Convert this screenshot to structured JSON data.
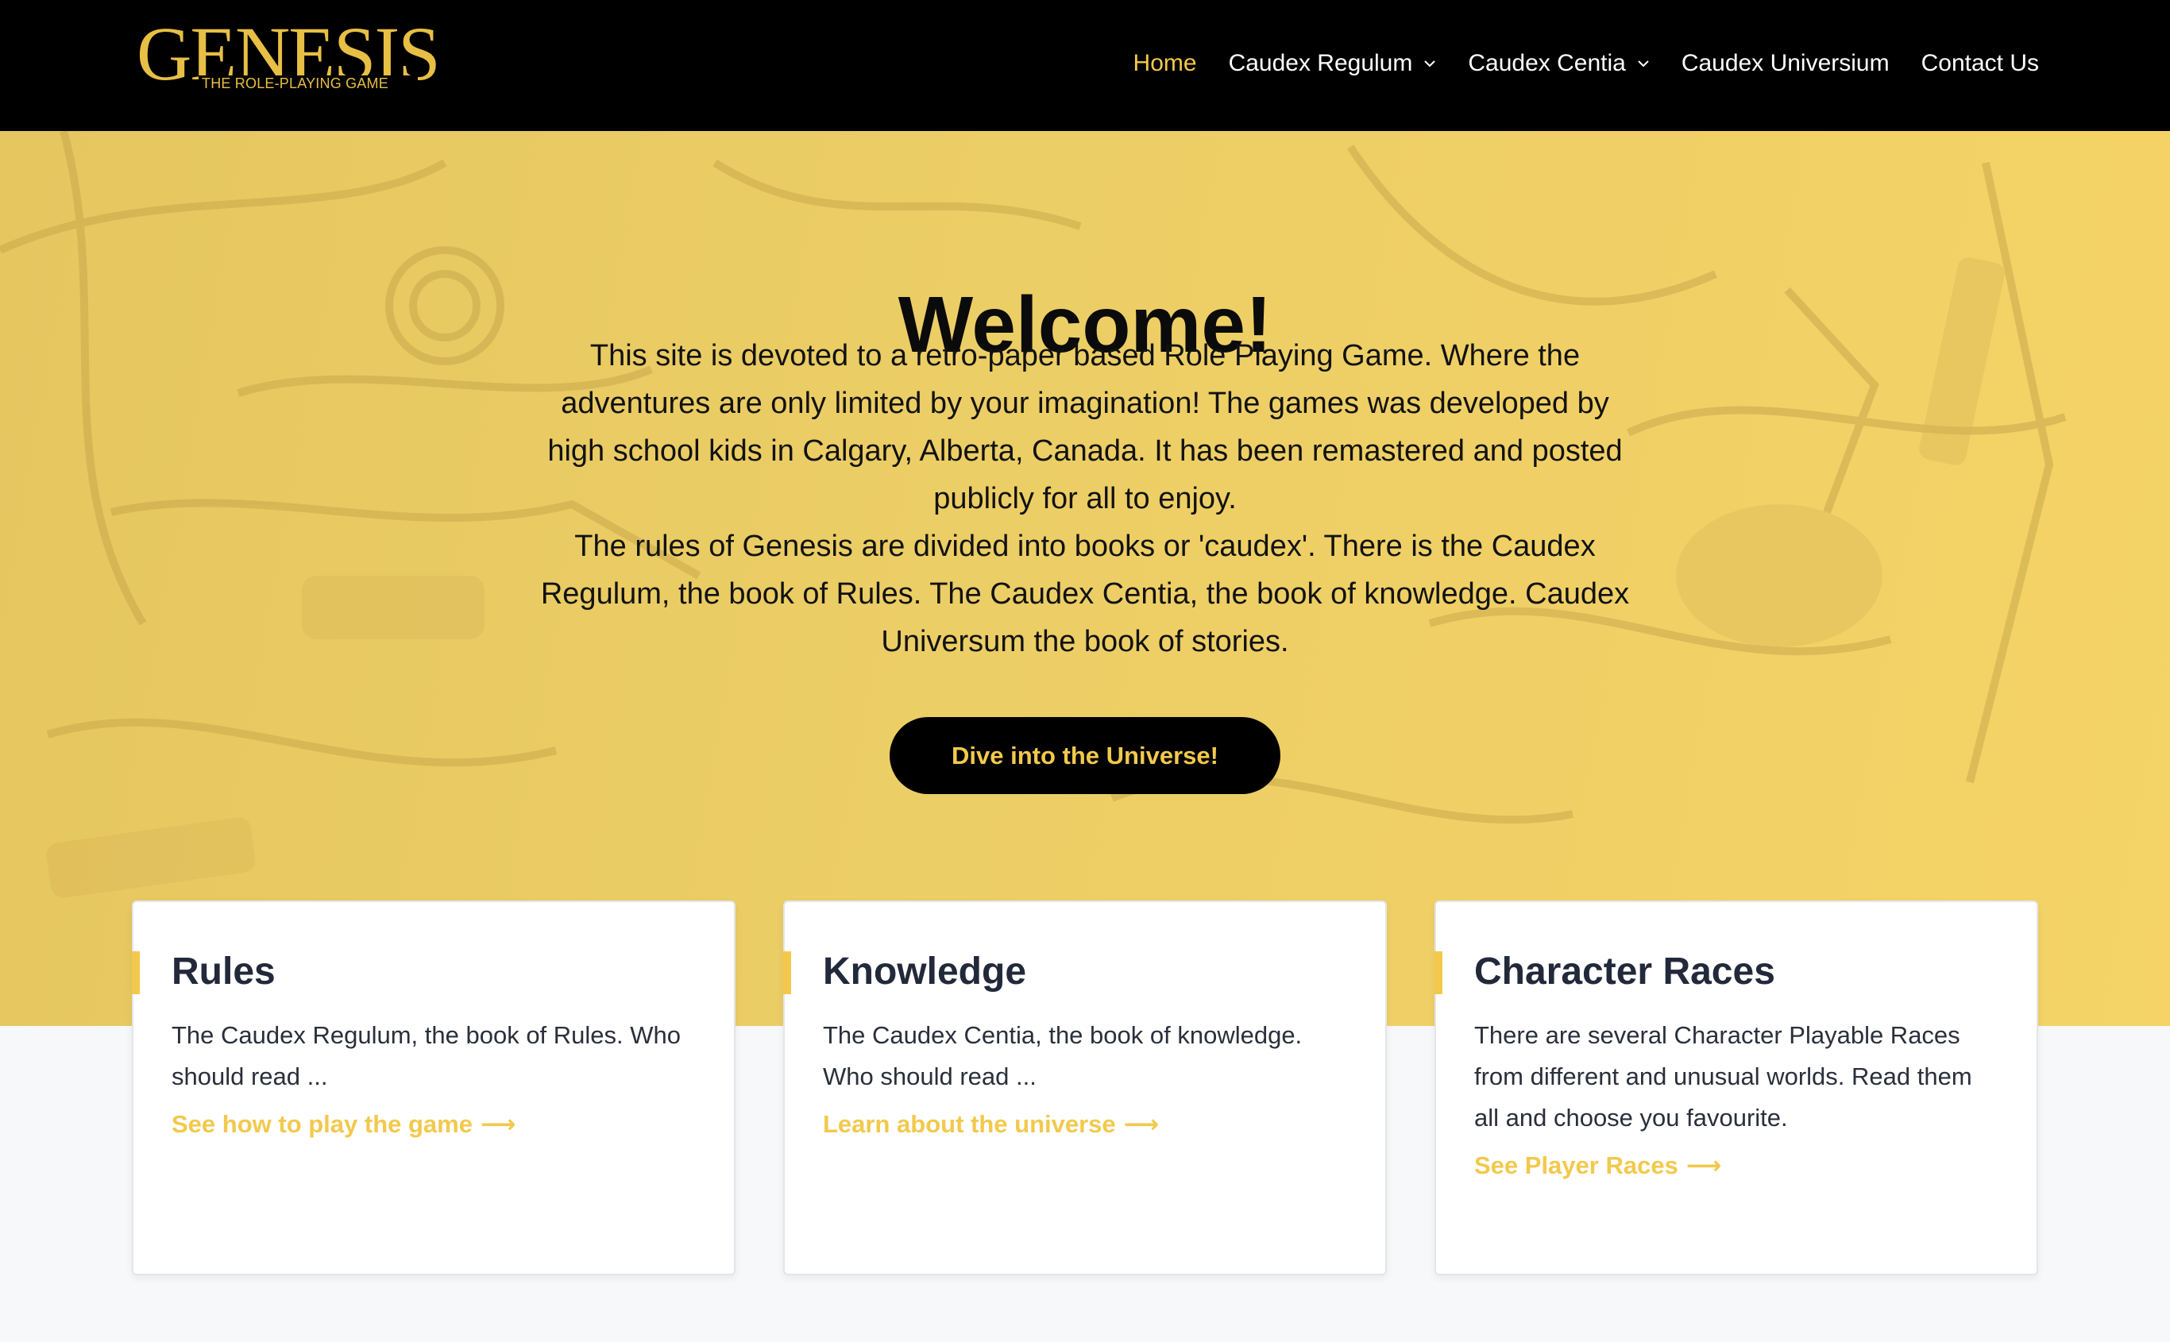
{
  "brand": {
    "name": "GENESIS",
    "tagline": "THE ROLE-PLAYING GAME",
    "accent": "#f2c94c"
  },
  "nav": {
    "items": [
      {
        "label": "Home",
        "active": true
      },
      {
        "label": "Caudex Regulum",
        "dropdown": true
      },
      {
        "label": "Caudex Centia",
        "dropdown": true
      },
      {
        "label": "Caudex Universium"
      },
      {
        "label": "Contact Us"
      }
    ]
  },
  "hero": {
    "title": "Welcome!",
    "paragraph1": "This site is devoted to a retro-paper based Role Playing Game. Where the adventures are only limited by your imagination! The games was developed by high school kids in Calgary, Alberta, Canada. It has been remastered and posted publicly for all to enjoy.",
    "paragraph2": "The rules of Genesis are divided into books or 'caudex'. There is the Caudex Regulum, the book of Rules. The Caudex Centia, the book of knowledge. Caudex Universum the book of stories.",
    "cta": "Dive into the Universe!"
  },
  "cards": [
    {
      "title": "Rules",
      "text": "The Caudex Regulum, the book of Rules. Who should read ...",
      "link": "See how to play the game",
      "arrow": "⟶"
    },
    {
      "title": "Knowledge",
      "text": "The Caudex Centia, the book of knowledge. Who should read ...",
      "link": "Learn about the universe",
      "arrow": "⟶"
    },
    {
      "title": "Character Races",
      "text": "There are several Character Playable Races from different and unusual worlds. Read them all and choose you favourite.",
      "link": "See Player Races",
      "arrow": "⟶"
    }
  ]
}
